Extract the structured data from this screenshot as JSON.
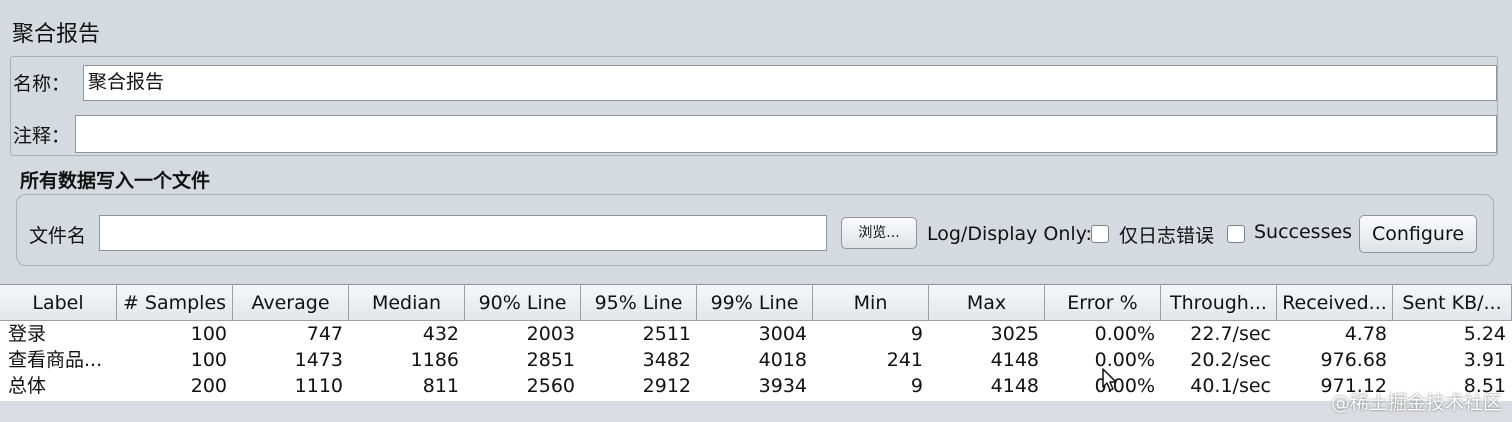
{
  "window": {
    "title": "聚合报告"
  },
  "form": {
    "name_label": "名称：",
    "name_value": "聚合报告",
    "comment_label": "注释：",
    "comment_value": ""
  },
  "file_section": {
    "title": "所有数据写入一个文件",
    "filename_label": "文件名",
    "filename_value": "",
    "browse_button": "浏览...",
    "log_display_label": "Log/Display Only:",
    "errors_only_label": "仅日志错误",
    "errors_only_checked": false,
    "successes_label": "Successes",
    "successes_checked": false,
    "configure_button": "Configure"
  },
  "table": {
    "headers": [
      "Label",
      "# Samples",
      "Average",
      "Median",
      "90% Line",
      "95% Line",
      "99% Line",
      "Min",
      "Max",
      "Error %",
      "Through...",
      "Received...",
      "Sent KB/..."
    ],
    "rows": [
      [
        "登录",
        "100",
        "747",
        "432",
        "2003",
        "2511",
        "3004",
        "9",
        "3025",
        "0.00%",
        "22.7/sec",
        "4.78",
        "5.24"
      ],
      [
        "查看商品...",
        "100",
        "1473",
        "1186",
        "2851",
        "3482",
        "4018",
        "241",
        "4148",
        "0.00%",
        "20.2/sec",
        "976.68",
        "3.91"
      ],
      [
        "总体",
        "200",
        "1110",
        "811",
        "2560",
        "2912",
        "3934",
        "9",
        "4148",
        "0.00%",
        "40.1/sec",
        "971.12",
        "8.51"
      ]
    ]
  },
  "watermark": "@稀土掘金技术社区",
  "colors": {
    "background": "#d5d9e0",
    "table_body": "#ffffff",
    "field_border": "#8e959d"
  }
}
